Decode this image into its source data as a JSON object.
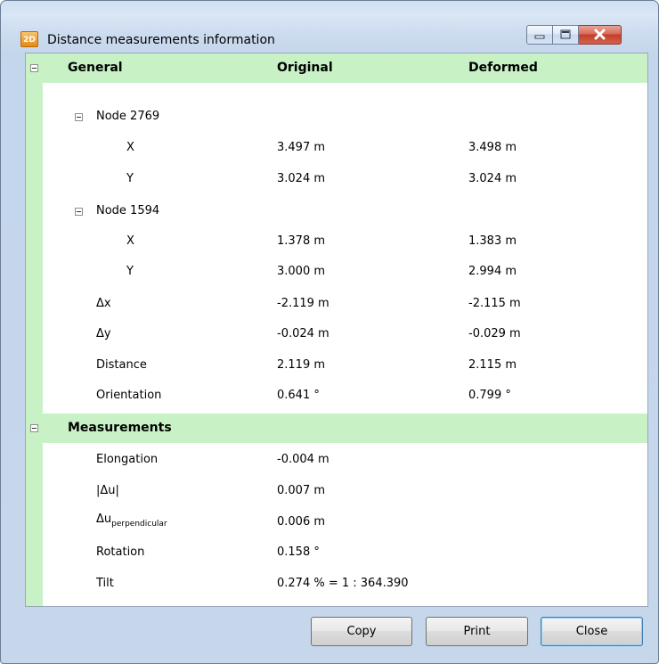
{
  "window": {
    "title": "Distance measurements information",
    "icon_text": "2D",
    "controls": {
      "minimize": "minimize-icon",
      "maximize": "maximize-icon",
      "close": "close-icon"
    }
  },
  "table": {
    "headers": {
      "name": "General",
      "original": "Original",
      "deformed": "Deformed"
    },
    "general": {
      "node1": {
        "label": "Node 2769",
        "x": {
          "label": "X",
          "original": "3.497 m",
          "deformed": "3.498 m"
        },
        "y": {
          "label": "Y",
          "original": "3.024 m",
          "deformed": "3.024 m"
        }
      },
      "node2": {
        "label": "Node 1594",
        "x": {
          "label": "X",
          "original": "1.378 m",
          "deformed": "1.383 m"
        },
        "y": {
          "label": "Y",
          "original": "3.000 m",
          "deformed": "2.994 m"
        }
      },
      "dx": {
        "label": "Δx",
        "original": "-2.119 m",
        "deformed": "-2.115 m"
      },
      "dy": {
        "label": "Δy",
        "original": "-0.024 m",
        "deformed": "-0.029 m"
      },
      "distance": {
        "label": "Distance",
        "original": "2.119 m",
        "deformed": "2.115 m"
      },
      "orientation": {
        "label": "Orientation",
        "original": "0.641 °",
        "deformed": "0.799 °"
      }
    },
    "measurements": {
      "label": "Measurements",
      "elongation": {
        "label": "Elongation",
        "value": "-0.004 m"
      },
      "du_abs": {
        "label": "|Δu|",
        "value": "0.007 m"
      },
      "du_perp": {
        "label": "Δu",
        "label_sub": "perpendicular",
        "value": "0.006 m"
      },
      "rotation": {
        "label": "Rotation",
        "value": "0.158 °"
      },
      "tilt": {
        "label": "Tilt",
        "value": "0.274 % = 1 : 364.390"
      }
    }
  },
  "buttons": {
    "copy": "Copy",
    "print": "Print",
    "close": "Close"
  }
}
